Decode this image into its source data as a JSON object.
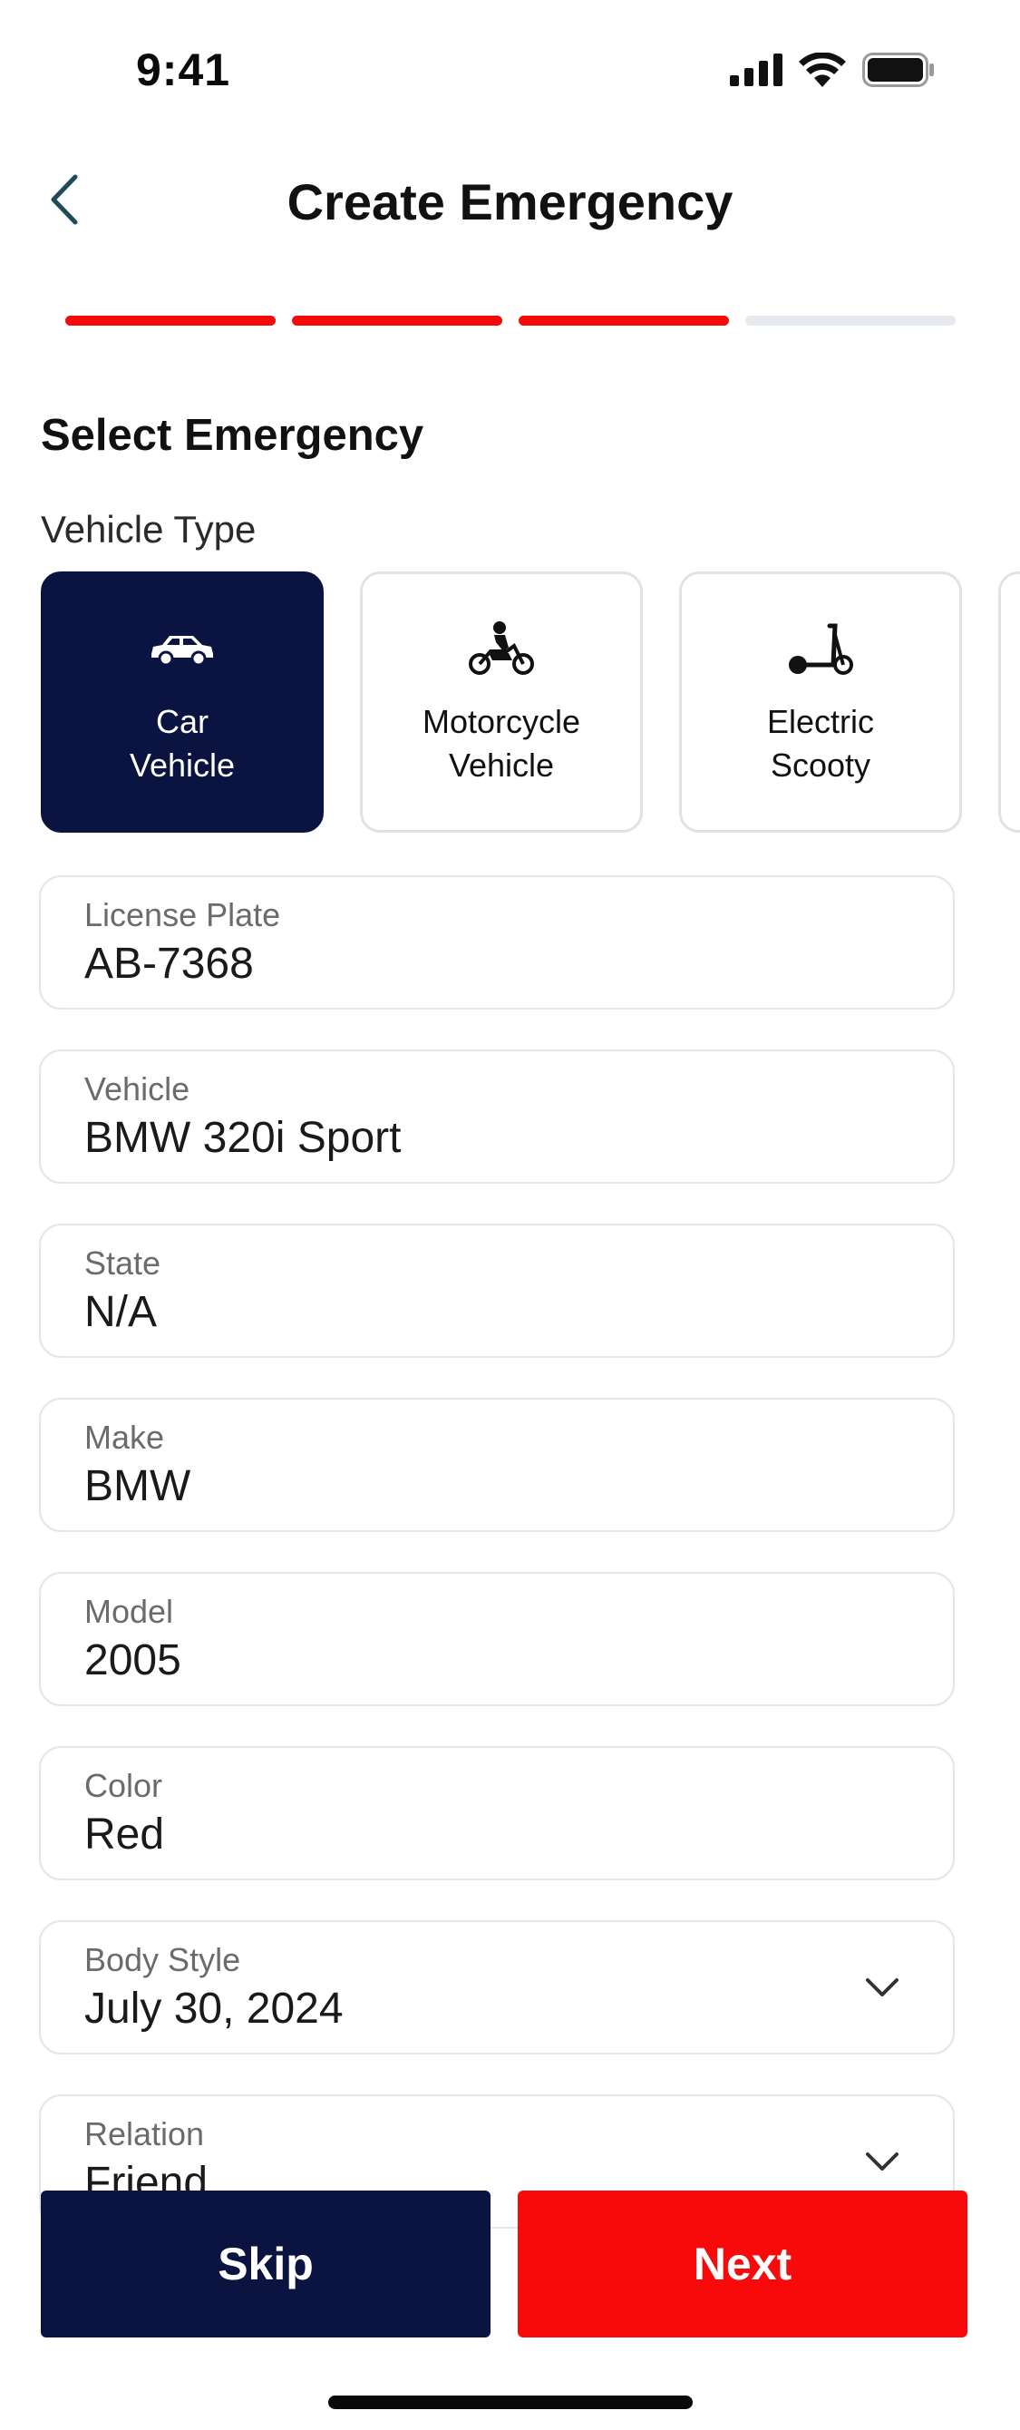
{
  "status_bar": {
    "time": "9:41"
  },
  "header": {
    "title": "Create Emergency"
  },
  "progress": {
    "total_steps": 4,
    "completed_steps": 3,
    "active_color": "#f50a0a",
    "inactive_color": "#e6e9ee"
  },
  "section": {
    "title": "Select Emergency",
    "vehicle_type_label": "Vehicle Type"
  },
  "vehicle_types": [
    {
      "label": "Car\nVehicle",
      "icon": "car-icon",
      "selected": true
    },
    {
      "label": "Motorcycle\nVehicle",
      "icon": "motorcycle-icon",
      "selected": false
    },
    {
      "label": "Electric\nScooty",
      "icon": "scooter-icon",
      "selected": false
    }
  ],
  "fields": {
    "license_plate": {
      "label": "License Plate",
      "value": "AB-7368"
    },
    "vehicle": {
      "label": "Vehicle",
      "value": "BMW 320i Sport"
    },
    "state": {
      "label": "State",
      "value": "N/A"
    },
    "make": {
      "label": "Make",
      "value": "BMW"
    },
    "model": {
      "label": "Model",
      "value": "2005"
    },
    "color": {
      "label": "Color",
      "value": "Red"
    },
    "body_style": {
      "label": "Body Style",
      "value": "July 30, 2024"
    },
    "relation": {
      "label": "Relation",
      "value": "Friend"
    }
  },
  "buttons": {
    "skip": "Skip",
    "next": "Next"
  },
  "colors": {
    "navy": "#0b1340",
    "red": "#f80a0a"
  }
}
